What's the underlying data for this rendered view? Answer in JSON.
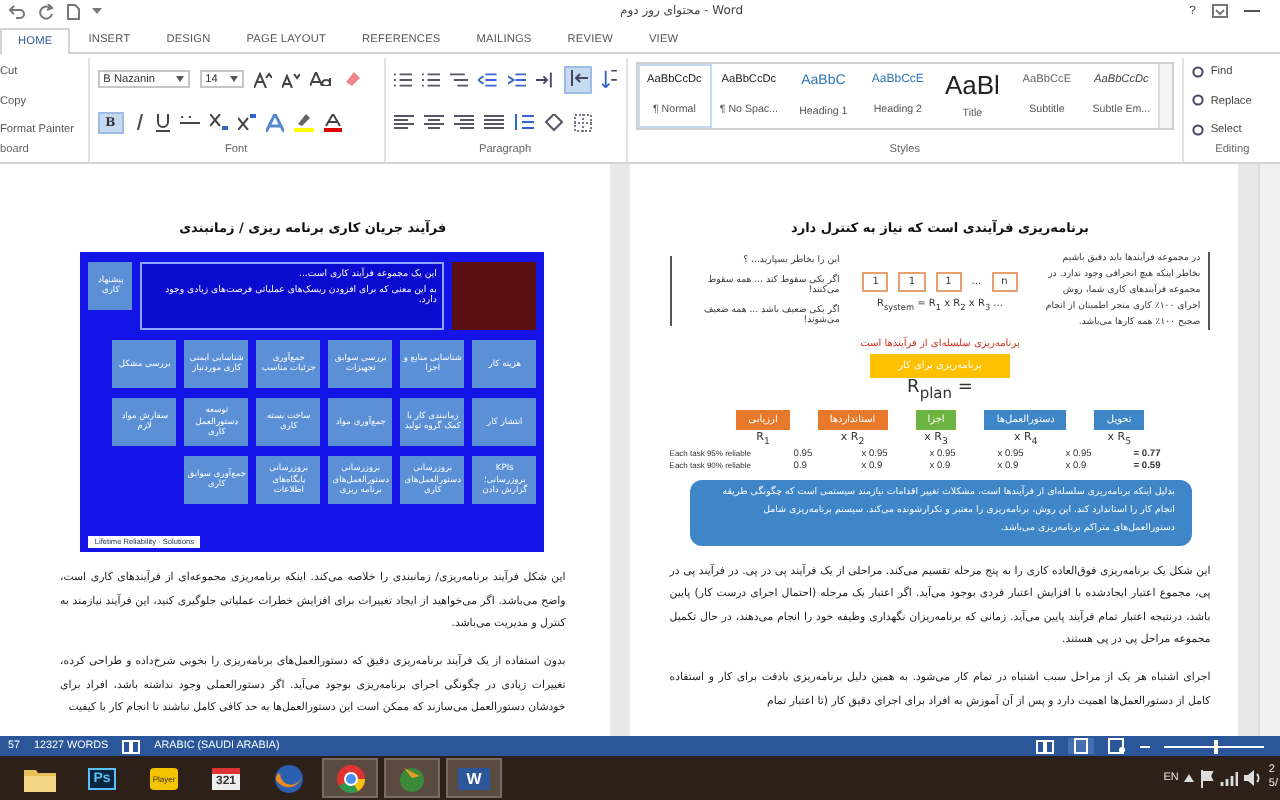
{
  "window": {
    "title": "محتوای روز دوم - Word",
    "help": "?"
  },
  "tabs": [
    {
      "label": "VIEW",
      "selected": false
    },
    {
      "label": "REVIEW",
      "selected": false
    },
    {
      "label": "MAILINGS",
      "selected": false
    },
    {
      "label": "REFERENCES",
      "selected": false
    },
    {
      "label": "PAGE LAYOUT",
      "selected": false
    },
    {
      "label": "DESIGN",
      "selected": false
    },
    {
      "label": "INSERT",
      "selected": false
    },
    {
      "label": "HOME",
      "selected": true
    }
  ],
  "clipboard": {
    "items": [
      "Cut",
      "Copy",
      "Format Painter"
    ],
    "label": "board"
  },
  "font": {
    "name": "B Nazanin",
    "size": "14",
    "label": "Font",
    "bold": {
      "label": "B",
      "on": true
    }
  },
  "paragraph": {
    "label": "Paragraph",
    "rtl_on": true
  },
  "styles": {
    "label": "Styles",
    "items": [
      {
        "sample": "AaBbCcDc",
        "name": "Subtle Em...",
        "kind": "emphasis",
        "selected": false
      },
      {
        "sample": "AaBbCcE",
        "name": "Subtitle",
        "kind": "subtitle",
        "selected": false
      },
      {
        "sample": "AaBl",
        "name": "Title",
        "kind": "title",
        "selected": false
      },
      {
        "sample": "AaBbCcE",
        "name": "Heading 2",
        "kind": "heading2",
        "selected": false
      },
      {
        "sample": "AaBbC",
        "name": "Heading 1",
        "kind": "heading1",
        "selected": false
      },
      {
        "sample": "AaBbCcDc",
        "name": "¶ No Spac...",
        "kind": "normal",
        "selected": false
      },
      {
        "sample": "AaBbCcDc",
        "name": "¶ Normal",
        "kind": "normal",
        "selected": true
      }
    ]
  },
  "editing": {
    "label": "Editing",
    "items": [
      "Find",
      "Replace",
      "Select"
    ]
  },
  "left_page": {
    "title": "فرآیند جریان کاری برنامه ریزی / زمانبندی",
    "slide": {
      "proposal": "پیشنهاد کاری",
      "note": [
        "این یک مجموعه فرآیند کاری است...",
        "به این معنی که برای افزودن ریسک‌های عملیاتی فرصت‌های زیادی وجود دارد."
      ],
      "rows": [
        [
          "هزینه کار",
          "شناسایی منابع و اجزا",
          "بررسی سوابق تجهیزات",
          "جمع‌آوری جزئیات مناسب",
          "شناسایی ایمنی کاری موردنیاز",
          "بررسی مشکل"
        ],
        [
          "انتشار کار",
          "زمانبندی کار با کمک گروه تولید",
          "جمع‌آوری مواد",
          "ساخت بسته کاری",
          "توسعه دستورالعمل کاری",
          "سفارش مواد لازم"
        ],
        [
          "KPIs بروزرسانی؛ گزارش دادن",
          "بروزرسانی دستورالعمل‌های کاری",
          "بروزرسانی دستورالعمل‌های برنامه ریزی",
          "بروزرسانی پایگاه‌های اطلاعات",
          "جمع‌آوری سوابق کاری"
        ]
      ],
      "logo": "Lifetime Reliability · Solutions"
    },
    "paragraphs": [
      "این شکل فرآیند برنامه‌ریزی/ زمانبندی را خلاصه می‌کند. اینکه برنامه‌ریزی مجموعه‌ای از فرآیندهای کاری است، واضح می‌باشد. اگر می‌خواهید از ایجاد تغییرات برای افزایش خطرات عملیاتی جلوگیری کنید، این فرآیند نیازمند به کنترل و مدیریت می‌باشد.",
      "بدون استفاده از یک فرآیند برنامه‌ریزی دقیق که دستورالعمل‌های برنامه‌ریزی را بخوبی شرح‌داده و طراحی کرده، تغییرات زیادی در چگونگی اجرای برنامه‌ریزی بوجود می‌آید. اگر دستورالعملی وجود نداشته باشد، افراد برای خودشان دستورالعمل می‌سازند که ممکن است این دستورالعمل‌ها به حد کافی کامل نباشند تا انجام کار با کیفیت"
    ]
  },
  "right_page": {
    "title": "برنامه‌ریزی فرآیندی است که نیاز به کنترل دارد",
    "intro": "در مجموعه فرآیندها باید دقیق باشیم بخاطر اینکه هیچ انحرافی وجود ندارد. در مجموعه فرآیندهای کاری شما، روش اجرای ۱۰۰٪ کاری منجر اطمینان از انجام صحیح ۱۰۰٪ همه کارها می‌باشد.",
    "chain": [
      "n",
      "1",
      "1",
      "1"
    ],
    "chain_gap": "...",
    "formula": "R$_{system}$ = R$_{1}$ x R$_{2}$ x R$_{3}$ ...",
    "remember": [
      "این را بخاطر بسپارید... ؟",
      "اگر یکی سقوط کند ... همه سقوط می‌کنند!",
      "اگر یکی ضعیف باشد ... همه ضعیف می‌شوند!"
    ],
    "series_note": "برنامه‌ریزی سلسله‌ای از فرآیندها است",
    "plan_box": "برنامه‌ریزی برای کار",
    "plan_formula": "R$_{plan}$ =",
    "steps": [
      {
        "label": "تحویل",
        "color": "#3f86c8",
        "factor": "x R$_{5}$"
      },
      {
        "label": "دستورالعمل‌ها",
        "color": "#3f86c8",
        "factor": "x R$_{4}$"
      },
      {
        "label": "اجزا",
        "color": "#6cb33f",
        "factor": "x R$_{3}$"
      },
      {
        "label": "استانداردها",
        "color": "#e8782a",
        "factor": "x R$_{2}$"
      },
      {
        "label": "ارزیابی",
        "color": "#e8782a",
        "factor": "R$_{1}$"
      }
    ],
    "reliability": [
      {
        "result": "= 0.77",
        "values": [
          "x 0.95",
          "x 0.95",
          "x 0.95",
          "x 0.95",
          "0.95"
        ],
        "label": "Each task 95% reliable"
      },
      {
        "result": "= 0.59",
        "values": [
          "x 0.9",
          "x 0.9",
          "x 0.9",
          "x 0.9",
          "0.9"
        ],
        "label": "Each task 90% reliable"
      }
    ],
    "callout": "بدلیل اینکه برنامه‌ریزی سلسله‌ای از فرآیندها است، مشکلات تغییر اقدامات نیازمند سیستمی است که چگونگی طریقه انجام کار را استاندارد کند. این روش، برنامه‌ریزی را معتبر و تکرارشونده می‌کند. سیستم برنامه‌ریزی شامل دستورالعمل‌های متراکم برنامه‌ریزی می‌باشد.",
    "paragraphs": [
      "این شکل یک برنامه‌ریزی فوق‌العاده کاری را به پنج مرحله تقسیم می‌کند. مراحلی از یک فرآیند پی در پی. در فرآیند پی در پی، مجموع اعتبار ایجادشده با افزایش اعتبار فردی بوجود می‌آید. اگر اعتبار یک مرحله (احتمال اجرای درست کار) پایین باشد، درنتیجه اعتبار تمام فرآیند پایین می‌آید. زمانی که برنامه‌ریزان نگهداری وظیفه خود را انجام می‌دهند، در حال تکمیل مجموعه مراحل پی در پی هستند.",
      "اجرای اشتباه هر یک از مراحل سبب اشتباه در تمام کار می‌شود. به همین دلیل برنامه‌ریزی بادقت برای کار و استفاده کامل از دستورالعمل‌ها اهمیت دارد و پس از آن آموزش به افراد برای اجرای دقیق کار (تا اعتبار تمام"
    ]
  },
  "status_bar": {
    "page": "57",
    "words": "12327 WORDS",
    "language": "ARABIC (SAUDI ARABIA)",
    "zoom": {
      "level": 0.5
    }
  },
  "taskbar": {
    "apps": [
      {
        "kind": "word",
        "label": "W",
        "running": true
      },
      {
        "kind": "download",
        "running": true
      },
      {
        "kind": "chrome",
        "running": true
      },
      {
        "kind": "firefox",
        "running": false
      },
      {
        "kind": "calendar",
        "label": "321",
        "running": false
      },
      {
        "kind": "player",
        "label": "Player",
        "running": false
      },
      {
        "kind": "ps",
        "label": "Ps",
        "running": false
      },
      {
        "kind": "folder",
        "running": false
      }
    ],
    "lang": "EN",
    "clock": "2",
    "date": "5/"
  }
}
